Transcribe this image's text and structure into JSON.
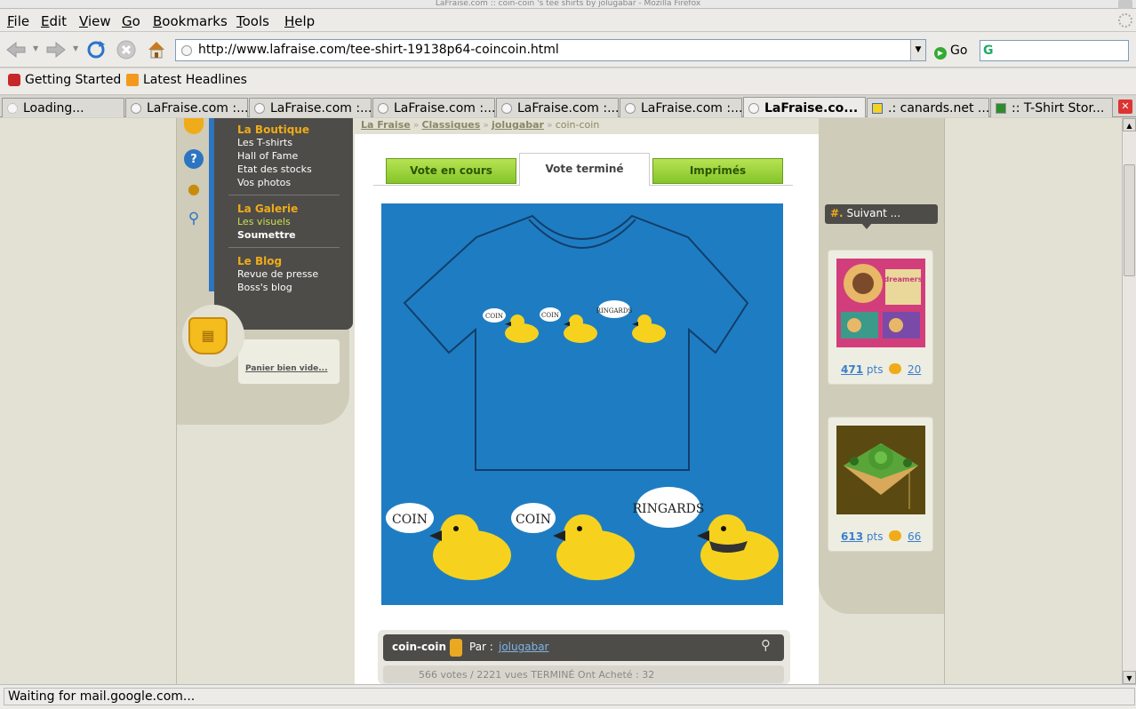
{
  "window": {
    "title": "LaFraise.com :: coin-coin 's tee shirts by jolugabar - Mozilla Firefox"
  },
  "menu": [
    "File",
    "Edit",
    "View",
    "Go",
    "Bookmarks",
    "Tools",
    "Help"
  ],
  "menu_accel": [
    "F",
    "E",
    "V",
    "G",
    "B",
    "T",
    "H"
  ],
  "nav": {
    "url": "http://www.lafraise.com/tee-shirt-19138p64-coincoin.html",
    "go_label": "Go",
    "search_value": ""
  },
  "bookmarks": [
    "Getting Started",
    "Latest Headlines"
  ],
  "tabs": [
    {
      "label": "Loading...",
      "active": false
    },
    {
      "label": "LaFraise.com :...",
      "active": false
    },
    {
      "label": "LaFraise.com :...",
      "active": false
    },
    {
      "label": "LaFraise.com :...",
      "active": false
    },
    {
      "label": "LaFraise.com :...",
      "active": false
    },
    {
      "label": "LaFraise.com :...",
      "active": false
    },
    {
      "label": "LaFraise.co...",
      "active": true
    },
    {
      "label": ".: canards.net ...",
      "active": false
    },
    {
      "label": ":: T-Shirt Stor...",
      "active": false
    }
  ],
  "status": "Waiting for mail.google.com...",
  "site": {
    "sidebar": {
      "boutique_title": "La Boutique",
      "boutique_items": [
        "Les T-shirts",
        "Hall of Fame",
        "Etat des stocks",
        "Vos photos"
      ],
      "galerie_title": "La Galerie",
      "galerie_items": [
        "Les visuels",
        "Soumettre"
      ],
      "blog_title": "Le Blog",
      "blog_items": [
        "Revue de presse",
        "Boss's blog"
      ],
      "cart": "Panier bien vide..."
    },
    "breadcrumb": [
      "La Fraise",
      "Classiques",
      "jolugabar",
      "coin-coin"
    ],
    "tabs": [
      "Vote en cours",
      "Vote terminé",
      "Imprimés"
    ],
    "design": {
      "speech": [
        "COIN",
        "COIN",
        "RINGARDS"
      ],
      "name": "coin-coin",
      "by_label": "Par :",
      "author": "jolugabar",
      "stats": "566 votes / 2221 vues    TERMINÉ    Ont Acheté : 32"
    },
    "next_label": "Suivant ...",
    "next_hash": "#.",
    "next_items": [
      {
        "points": "471",
        "pts_label": "pts",
        "comments": "20",
        "art_text": "all the dreamers rule the world."
      },
      {
        "points": "613",
        "pts_label": "pts",
        "comments": "66"
      }
    ]
  },
  "colors": {
    "shirt_bg": "#1e7dc2",
    "accent": "#f0ab1a",
    "green_tab": "#9bd13b",
    "dark_panel": "#4d4c48"
  }
}
